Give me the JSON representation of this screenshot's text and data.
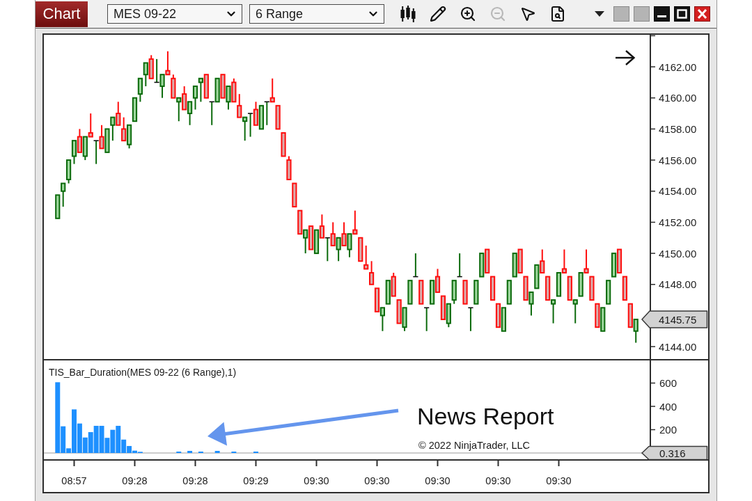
{
  "toolbar": {
    "menu_button": "Chart",
    "instrument": {
      "value": "MES 09-22"
    },
    "bar_type": {
      "value": "6 Range"
    },
    "tools": [
      {
        "kind": "chart-style",
        "disabled": false
      },
      {
        "kind": "drawing",
        "disabled": false
      },
      {
        "kind": "zoom-in",
        "disabled": false
      },
      {
        "kind": "zoom-out",
        "disabled": true
      },
      {
        "kind": "pointer",
        "disabled": false
      },
      {
        "kind": "data-box",
        "disabled": false
      }
    ]
  },
  "price_panel": {
    "chart_data": {
      "type": "candlestick",
      "ohlc": [
        null,
        null,
        [
          4152.25,
          4153.75,
          4152.25,
          4153.75
        ],
        [
          4154,
          4154.5,
          4153,
          4154.5
        ],
        [
          4154.75,
          4156,
          4154.5,
          4156
        ],
        [
          4156.25,
          4157.25,
          4155.75,
          4157.25
        ],
        [
          4157.5,
          4158,
          4156.5,
          4156.5
        ],
        [
          4156.25,
          4157.5,
          4156,
          4157.5
        ],
        [
          4157.75,
          4159,
          4157.5,
          4157.5
        ],
        [
          4157.25,
          4157.25,
          4155.75,
          4157.25
        ],
        [
          4157.5,
          4158.25,
          4156.75,
          4156.75
        ],
        [
          4156.5,
          4158,
          4156.5,
          4158
        ],
        [
          4158.25,
          4158.75,
          4157.25,
          4158.75
        ],
        [
          4159,
          4159.75,
          4158.25,
          4158.25
        ],
        [
          4158,
          4158.75,
          4157.25,
          4157.25
        ],
        [
          4157,
          4158.25,
          4156.75,
          4158.25
        ],
        [
          4158.5,
          4160,
          4158.5,
          4160
        ],
        [
          4160.25,
          4161.25,
          4159.75,
          4161.25
        ],
        [
          4161.5,
          4162.25,
          4160.75,
          4162.25
        ],
        [
          4162.5,
          4162.75,
          4161.25,
          4161.25
        ],
        [
          4161,
          4162.5,
          4161,
          4161
        ],
        [
          4160.75,
          4161.5,
          4160,
          4161.5
        ],
        [
          4161.75,
          4163,
          4161.5,
          4161.5
        ],
        [
          4161.25,
          4161.5,
          4160,
          4160
        ],
        [
          4159.75,
          4160,
          4158.5,
          4160
        ],
        [
          4160.25,
          4160.75,
          4159.25,
          4159.25
        ],
        [
          4159,
          4159.75,
          4158.25,
          4159.75
        ],
        [
          4160,
          4160.75,
          4159.25,
          4160.75
        ],
        [
          4161,
          4161.25,
          4159.75,
          4161.25
        ],
        [
          4161.5,
          4161.5,
          4160,
          4160
        ],
        [
          4159.75,
          4159.75,
          4158.25,
          4159.75
        ],
        [
          4159.75,
          4161.25,
          4159.75,
          4161.25
        ],
        [
          4161.5,
          4161.5,
          4160,
          4160
        ],
        [
          4159.75,
          4160.75,
          4159.25,
          4160.75
        ],
        [
          4161,
          4161.25,
          4159.75,
          4159.75
        ],
        [
          4159.5,
          4160.25,
          4158.75,
          4158.75
        ],
        [
          4158.5,
          4158.75,
          4157.25,
          4158.75
        ],
        [
          4159,
          4159,
          4157.5,
          4159
        ],
        [
          4159.25,
          4159.75,
          4158.25,
          4158.25
        ],
        [
          4158,
          4159.5,
          4158,
          4159.5
        ],
        [
          4159.75,
          4159.75,
          4158.25,
          4159.75
        ],
        [
          4160,
          4161.25,
          4159.75,
          4159.75
        ],
        [
          4159.5,
          4159.5,
          4158,
          4158
        ],
        [
          4157.75,
          4157.75,
          4156.25,
          4156.25
        ],
        [
          4156,
          4156.25,
          4154.75,
          4154.75
        ],
        [
          4154.5,
          4154.5,
          4153,
          4153
        ],
        [
          4152.75,
          4152.75,
          4151.25,
          4151.25
        ],
        [
          4151,
          4151.5,
          4150,
          4151.5
        ],
        [
          4151.75,
          4151.75,
          4150.25,
          4150.25
        ],
        [
          4150,
          4151.5,
          4150,
          4151.5
        ],
        [
          4151.75,
          4152.5,
          4151,
          4151
        ],
        [
          4151,
          4151,
          4149.5,
          4151
        ],
        [
          4151.25,
          4152,
          4150.5,
          4150.5
        ],
        [
          4150.25,
          4151,
          4149.5,
          4151
        ],
        [
          4151.25,
          4152,
          4150.5,
          4150.5
        ],
        [
          4150.25,
          4151.25,
          4149.75,
          4151.25
        ],
        [
          4151.5,
          4152.75,
          4151.25,
          4151.25
        ],
        [
          4151,
          4151,
          4149.5,
          4149.5
        ],
        [
          4149.25,
          4150.5,
          4149,
          4149
        ],
        [
          4148.75,
          4149.5,
          4148,
          4148
        ],
        [
          4147.75,
          4147.75,
          4146.25,
          4146.25
        ],
        [
          4146,
          4146.5,
          4145,
          4146.5
        ],
        [
          4146.75,
          4148.25,
          4146.75,
          4148.25
        ],
        [
          4148.5,
          4148.75,
          4147.25,
          4147.25
        ],
        [
          4147,
          4147,
          4145.5,
          4145.5
        ],
        [
          4145.25,
          4146.5,
          4145,
          4146.5
        ],
        [
          4146.75,
          4148.25,
          4146.75,
          4148.25
        ],
        [
          4148.5,
          4150,
          4148.5,
          4148.5
        ],
        [
          4148.25,
          4148.25,
          4146.75,
          4146.75
        ],
        [
          4146.5,
          4146.5,
          4145,
          4146.5
        ],
        [
          4146.75,
          4148.25,
          4146.75,
          4148.25
        ],
        [
          4148.5,
          4149,
          4147.5,
          4147.5
        ],
        [
          4147.25,
          4147.25,
          4145.75,
          4145.75
        ],
        [
          4145.5,
          4146.75,
          4145.25,
          4146.75
        ],
        [
          4147,
          4148.25,
          4146.75,
          4148.25
        ],
        [
          4148.5,
          4150,
          4148.5,
          4148.5
        ],
        [
          4148.25,
          4148.25,
          4146.75,
          4146.75
        ],
        [
          4146.5,
          4146.5,
          4145,
          4146.5
        ],
        [
          4146.75,
          4148.25,
          4146.75,
          4148.25
        ],
        [
          4148.5,
          4150,
          4148.5,
          4150
        ],
        [
          4150.25,
          4150.25,
          4148.75,
          4148.75
        ],
        [
          4148.5,
          4148.5,
          4147,
          4147
        ],
        [
          4146.75,
          4146.75,
          4145.25,
          4145.25
        ],
        [
          4145,
          4146.5,
          4145,
          4146.5
        ],
        [
          4146.75,
          4148.25,
          4146.75,
          4148.25
        ],
        [
          4148.5,
          4150,
          4148.5,
          4150
        ],
        [
          4150.25,
          4150.25,
          4148.75,
          4148.75
        ],
        [
          4148.5,
          4148.5,
          4147,
          4147
        ],
        [
          4146.75,
          4147.5,
          4146,
          4147.5
        ],
        [
          4147.75,
          4149.25,
          4147.75,
          4149.25
        ],
        [
          4149.5,
          4150.25,
          4148.75,
          4148.75
        ],
        [
          4148.5,
          4148.5,
          4147,
          4147
        ],
        [
          4146.75,
          4147,
          4145.5,
          4147
        ],
        [
          4147.25,
          4148.75,
          4147.25,
          4148.75
        ],
        [
          4149,
          4150.25,
          4148.75,
          4148.75
        ],
        [
          4148.5,
          4148.5,
          4147,
          4147
        ],
        [
          4146.75,
          4147,
          4145.5,
          4147
        ],
        [
          4147.25,
          4148.75,
          4147.25,
          4148.75
        ],
        [
          4149,
          4150.25,
          4148.75,
          4148.75
        ],
        [
          4148.5,
          4148.5,
          4147,
          4147
        ],
        [
          4146.75,
          4146.75,
          4145.25,
          4145.25
        ],
        [
          4145,
          4146.5,
          4145,
          4146.5
        ],
        [
          4146.75,
          4148.25,
          4146.75,
          4148.25
        ],
        [
          4148.5,
          4150,
          4148.5,
          4150
        ],
        [
          4150.25,
          4150.25,
          4148.75,
          4148.75
        ],
        [
          4148.5,
          4148.5,
          4147,
          4147
        ],
        [
          4146.75,
          4146.75,
          4145.25,
          4145.25
        ],
        [
          4145,
          4145.75,
          4144.25,
          4145.75
        ],
        null,
        null
      ],
      "ylim": [
        4143.2,
        4164.06
      ],
      "yticks": [
        {
          "value": 4162,
          "label": "4162.00"
        },
        {
          "value": 4160,
          "label": "4160.00"
        },
        {
          "value": 4158,
          "label": "4158.00"
        },
        {
          "value": 4156,
          "label": "4156.00"
        },
        {
          "value": 4154,
          "label": "4154.00"
        },
        {
          "value": 4152,
          "label": "4152.00"
        },
        {
          "value": 4150,
          "label": "4150.00"
        },
        {
          "value": 4148,
          "label": "4148.00"
        },
        {
          "value": 4144,
          "label": "4144.00"
        }
      ]
    },
    "last_price": "4145.75"
  },
  "indicator_panel": {
    "chart_data": {
      "type": "bar",
      "title": "TIS_Bar_Duration(MES 09-22 (6 Range),1)",
      "values": [
        null,
        null,
        607,
        229,
        40,
        374,
        253,
        133,
        179,
        233,
        233,
        130,
        199,
        233,
        115,
        60,
        20,
        10,
        null,
        null,
        null,
        null,
        null,
        null,
        12,
        null,
        18,
        null,
        12,
        null,
        null,
        18,
        null,
        null,
        12,
        null,
        null,
        null,
        12,
        null,
        null,
        null,
        null,
        null,
        null,
        null,
        null,
        null,
        null,
        null,
        null,
        null,
        null,
        null,
        null,
        null,
        null,
        null,
        null,
        null,
        null,
        null,
        null,
        null,
        null,
        null,
        null,
        null,
        null,
        null,
        null,
        null,
        null,
        null,
        null,
        null,
        null,
        null,
        null,
        null,
        null,
        null,
        null,
        null,
        null,
        null,
        null,
        null,
        null,
        null,
        null,
        null,
        null,
        null,
        null,
        null,
        null,
        null,
        null,
        null,
        null,
        null,
        null,
        null,
        null,
        null,
        null,
        null,
        null,
        null
      ],
      "ylim": [
        0,
        800
      ],
      "yticks": [
        200,
        400,
        600
      ]
    },
    "current_value": "0.316",
    "copyright": "© 2022 NinjaTrader, LLC",
    "annotation": "News Report"
  },
  "time_axis": {
    "labels": [
      "08:57",
      "09:28",
      "09:28",
      "09:29",
      "09:30",
      "09:30",
      "09:30",
      "09:30",
      "09:30"
    ]
  }
}
